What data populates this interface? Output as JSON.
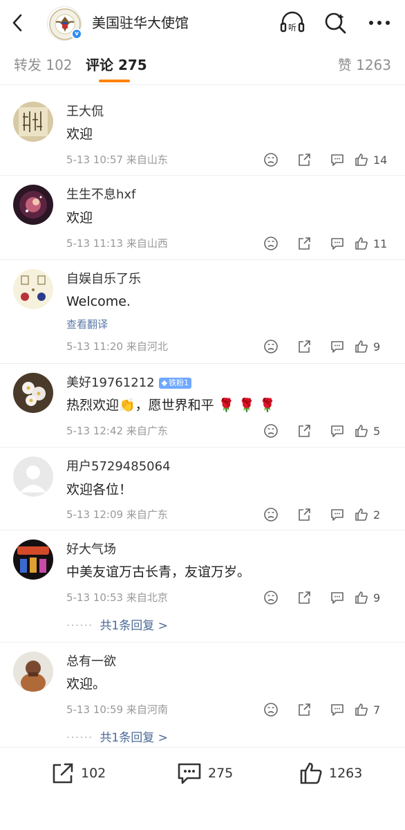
{
  "header": {
    "account_name": "美国驻华大使馆",
    "verify_mark": "v"
  },
  "tabs": {
    "repost_label": "转发 102",
    "comments_label": "评论 275",
    "likes_label": "赞 1263"
  },
  "comments": [
    {
      "name": "王大侃",
      "text": "欢迎",
      "time": "5-13 10:57",
      "location": "来自山东",
      "likes": "14"
    },
    {
      "name": "生生不息hxf",
      "text": "欢迎",
      "time": "5-13 11:13",
      "location": "来自山西",
      "likes": "11"
    },
    {
      "name": "自娱自乐了乐",
      "text": "Welcome.",
      "translate": "查看翻译",
      "time": "5-13 11:20",
      "location": "来自河北",
      "likes": "9"
    },
    {
      "name": "美好19761212",
      "badge": "铁粉1",
      "text": "热烈欢迎👏，愿世界和平 🌹 🌹 🌹",
      "time": "5-13 12:42",
      "location": "来自广东",
      "likes": "5"
    },
    {
      "name": "用户5729485064",
      "text": "欢迎各位！",
      "time": "5-13 12:09",
      "location": "来自广东",
      "likes": "2"
    },
    {
      "name": "好大气场",
      "text": "中美友谊万古长青，友谊万岁。",
      "time": "5-13 10:53",
      "location": "来自北京",
      "likes": "9",
      "replies": "共1条回复 >"
    },
    {
      "name": "总有一欲",
      "text": "欢迎。",
      "time": "5-13 10:59",
      "location": "来自河南",
      "likes": "7",
      "replies": "共1条回复 >"
    }
  ],
  "bottom": {
    "repost": "102",
    "comment": "275",
    "like": "1263"
  },
  "colors": {
    "accent": "#ff8200",
    "link": "#4b6a96",
    "badge": "#6fa8ff",
    "verify": "#2d8cf0"
  },
  "icons": [
    "back-arrow-icon",
    "listen-icon",
    "search-icon",
    "more-icon",
    "dislike-face-icon",
    "repost-icon",
    "comment-icon",
    "like-icon"
  ]
}
